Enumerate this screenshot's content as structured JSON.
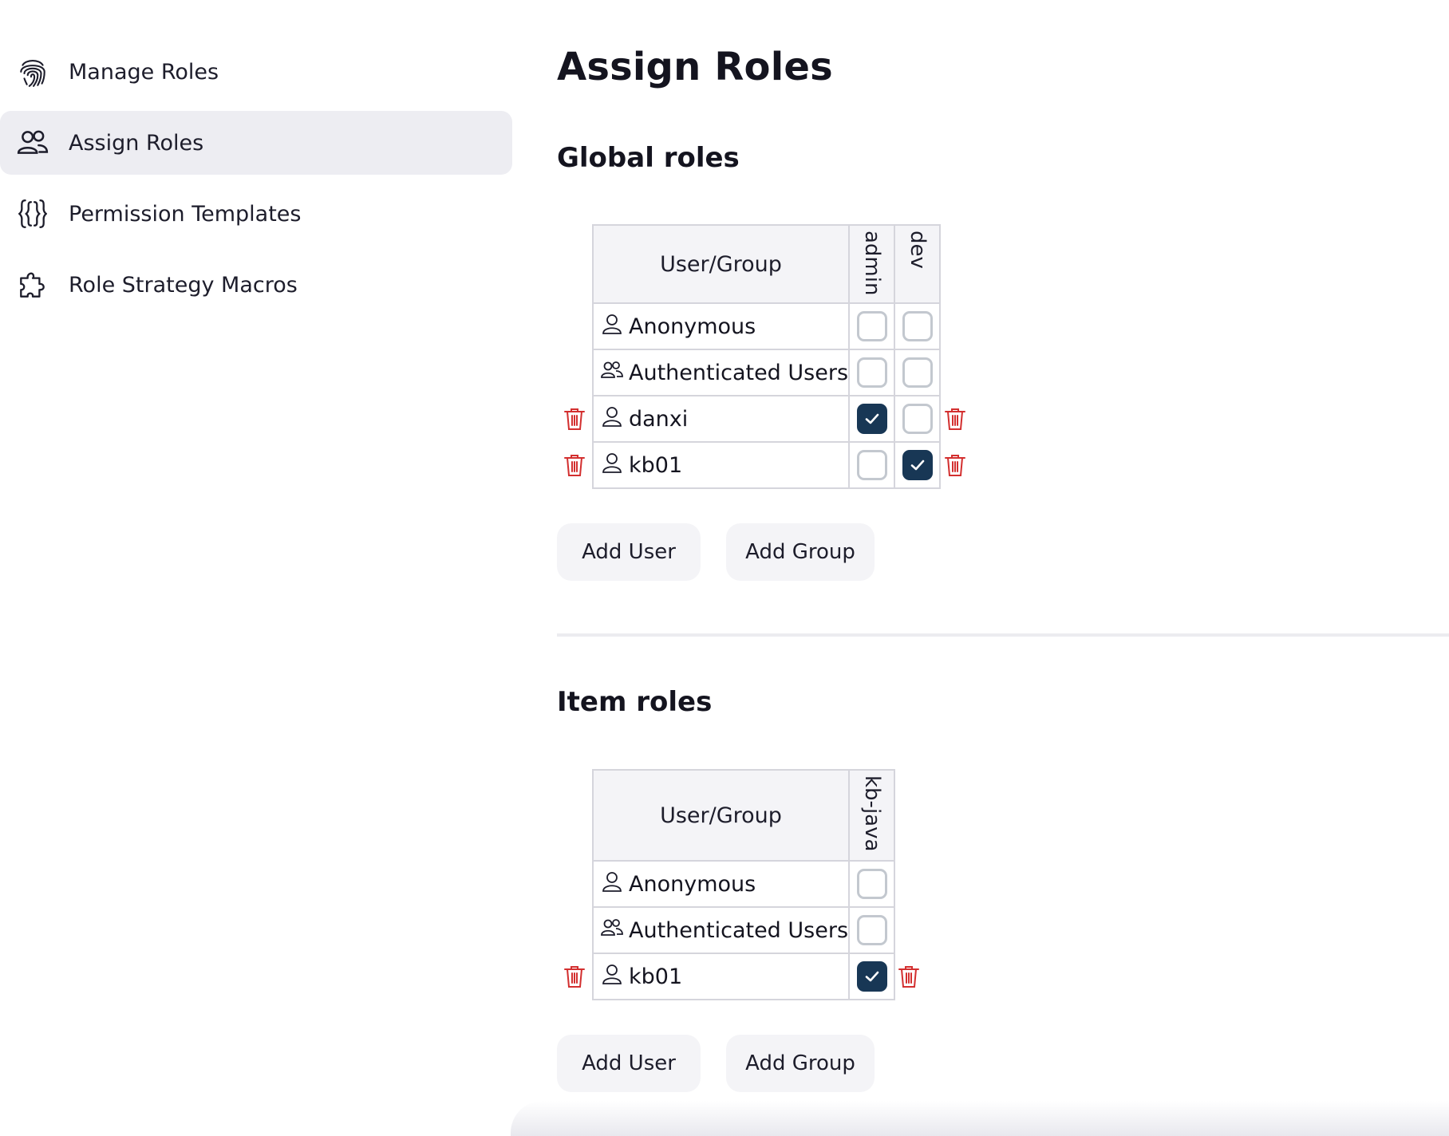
{
  "sidebar": {
    "items": [
      {
        "label": "Manage Roles",
        "icon": "fingerprint-icon",
        "active": false
      },
      {
        "label": "Assign Roles",
        "icon": "users-icon",
        "active": true
      },
      {
        "label": "Permission Templates",
        "icon": "braces-icon",
        "active": false
      },
      {
        "label": "Role Strategy Macros",
        "icon": "puzzle-icon",
        "active": false
      }
    ]
  },
  "main": {
    "title": "Assign Roles",
    "global": {
      "title": "Global roles",
      "header": "User/Group",
      "roles": [
        "admin",
        "dev"
      ],
      "rows": [
        {
          "name": "Anonymous",
          "type": "user",
          "checks": [
            false,
            false
          ],
          "deletable": false
        },
        {
          "name": "Authenticated Users",
          "type": "group",
          "checks": [
            false,
            false
          ],
          "deletable": false
        },
        {
          "name": "danxi",
          "type": "user",
          "checks": [
            true,
            false
          ],
          "deletable": true
        },
        {
          "name": "kb01",
          "type": "user",
          "checks": [
            false,
            true
          ],
          "deletable": true
        }
      ],
      "add_user": "Add User",
      "add_group": "Add Group"
    },
    "item": {
      "title": "Item roles",
      "header": "User/Group",
      "roles": [
        "kb-java"
      ],
      "rows": [
        {
          "name": "Anonymous",
          "type": "user",
          "checks": [
            false
          ],
          "deletable": false
        },
        {
          "name": "Authenticated Users",
          "type": "group",
          "checks": [
            false
          ],
          "deletable": false
        },
        {
          "name": "kb01",
          "type": "user",
          "checks": [
            true
          ],
          "deletable": true
        }
      ],
      "add_user": "Add User",
      "add_group": "Add Group"
    }
  },
  "colors": {
    "accent_checked": "#183755",
    "delete_red": "#d32f2f",
    "sidebar_active_bg": "#ededf2"
  }
}
